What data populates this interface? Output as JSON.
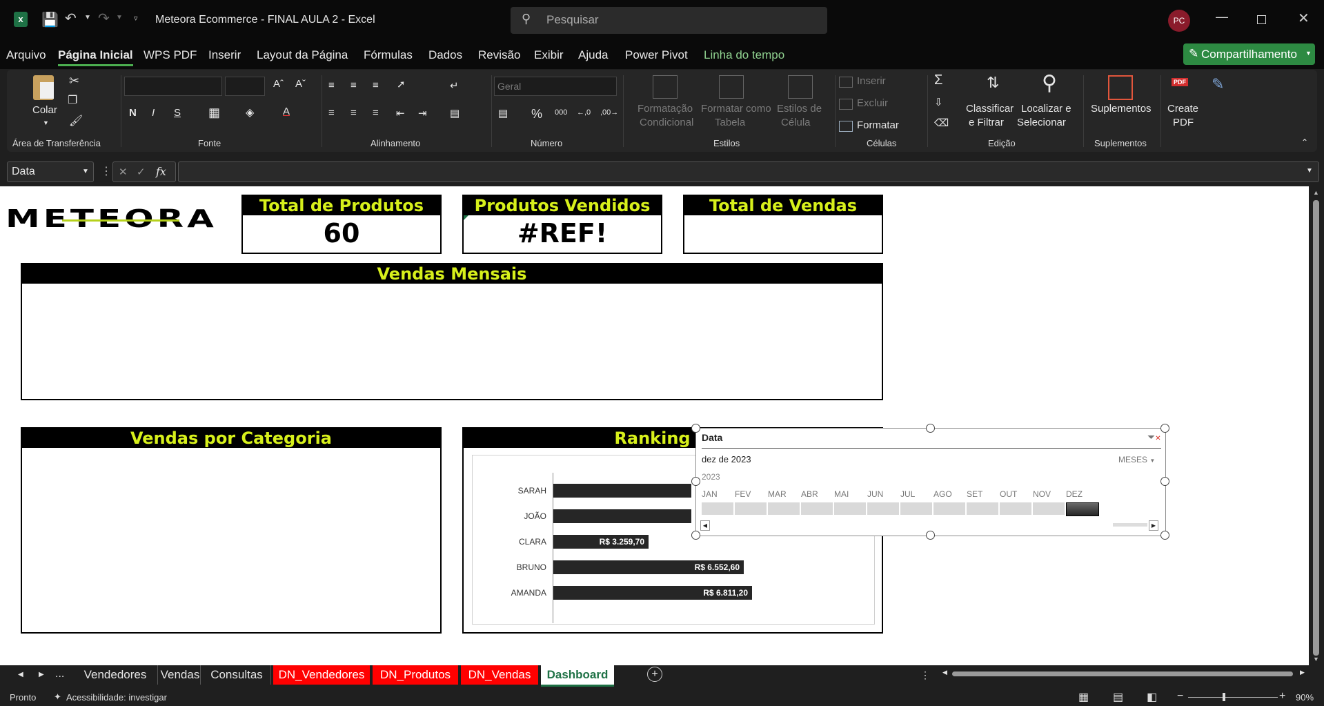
{
  "window": {
    "title": "Meteora Ecommerce - FINAL AULA 2  -  Excel",
    "search_placeholder": "Pesquisar",
    "user_initials": "PC"
  },
  "menu": {
    "items": [
      "Arquivo",
      "Página Inicial",
      "WPS PDF",
      "Inserir",
      "Layout da Página",
      "Fórmulas",
      "Dados",
      "Revisão",
      "Exibir",
      "Ajuda",
      "Power Pivot",
      "Linha do tempo"
    ],
    "active": "Página Inicial",
    "share_label": "Compartilhamento"
  },
  "ribbon": {
    "clipboard": {
      "paste": "Colar",
      "group": "Área de Transferência"
    },
    "font": {
      "group": "Fonte",
      "bold": "N",
      "italic": "I",
      "underline": "S"
    },
    "alignment": {
      "group": "Alinhamento"
    },
    "number": {
      "group": "Número",
      "format": "Geral"
    },
    "styles": {
      "group": "Estilos",
      "cond_format_1": "Formatação",
      "cond_format_2": "Condicional",
      "format_table_1": "Formatar como",
      "format_table_2": "Tabela",
      "cell_styles_1": "Estilos de",
      "cell_styles_2": "Célula"
    },
    "cells": {
      "group": "Células",
      "insert": "Inserir",
      "delete": "Excluir",
      "format": "Formatar"
    },
    "editing": {
      "group": "Edição",
      "sort_1": "Classificar",
      "sort_2": "e Filtrar",
      "find_1": "Localizar e",
      "find_2": "Selecionar"
    },
    "addins": {
      "group": "Suplementos",
      "label": "Suplementos"
    },
    "pdf": {
      "label_1": "Create",
      "label_2": "PDF",
      "badge": "PDF"
    }
  },
  "formula_bar": {
    "name_box": "Data",
    "fx": "fx",
    "formula": ""
  },
  "dashboard": {
    "logo": "METEORA",
    "kpis": [
      {
        "title": "Total de Produtos",
        "value": "60"
      },
      {
        "title": "Produtos Vendidos",
        "value": "#REF!"
      },
      {
        "title": "Total de Vendas",
        "value": ""
      }
    ],
    "monthly_title": "Vendas Mensais",
    "category_title": "Vendas por Categoria",
    "ranking_title": "Ranking Ven",
    "ranking": [
      {
        "name": "SARAH",
        "label": ""
      },
      {
        "name": "JOÃO",
        "label": ""
      },
      {
        "name": "CLARA",
        "label": "R$ 3.259,70"
      },
      {
        "name": "BRUNO",
        "label": "R$ 6.552,60"
      },
      {
        "name": "AMANDA",
        "label": "R$ 6.811,20"
      }
    ]
  },
  "slicer": {
    "title": "Data",
    "selection": "dez de 2023",
    "level": "MESES",
    "year": "2023",
    "months": [
      "JAN",
      "FEV",
      "MAR",
      "ABR",
      "MAI",
      "JUN",
      "JUL",
      "AGO",
      "SET",
      "OUT",
      "NOV",
      "DEZ"
    ],
    "selected_month": "DEZ"
  },
  "sheet_tabs": {
    "items": [
      {
        "label": "Vendedores",
        "style": "normal"
      },
      {
        "label": "Vendas",
        "style": "normal"
      },
      {
        "label": "Consultas",
        "style": "normal"
      },
      {
        "label": "DN_Vendedores",
        "style": "red"
      },
      {
        "label": "DN_Produtos",
        "style": "red"
      },
      {
        "label": "DN_Vendas",
        "style": "red"
      },
      {
        "label": "Dashboard",
        "style": "active"
      }
    ],
    "more": "..."
  },
  "status": {
    "ready": "Pronto",
    "accessibility": "Acessibilidade: investigar",
    "zoom": "90%"
  },
  "colors": {
    "accent": "#d7f01b",
    "share": "#2d8a42",
    "tab_red": "#ff0000",
    "active_tab_text": "#1e7145"
  }
}
